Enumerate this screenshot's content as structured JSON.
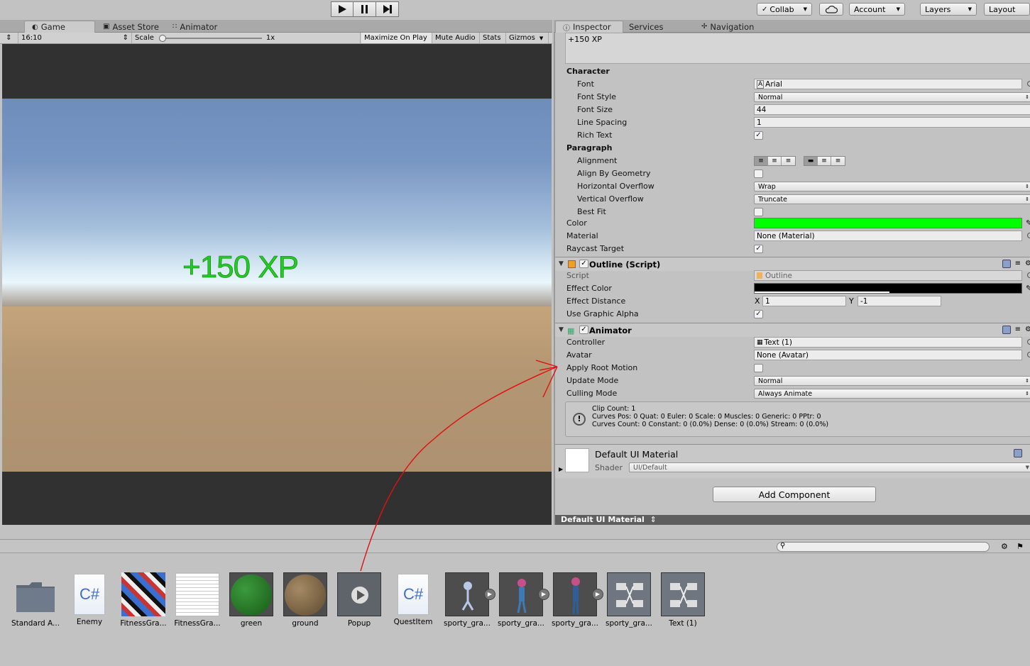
{
  "toolbar": {
    "play_icon": "play-icon",
    "pause_icon": "pause-icon",
    "step_icon": "step-icon",
    "collab": "Collab",
    "account": "Account",
    "layers": "Layers",
    "layout": "Layout"
  },
  "game_tabs": {
    "game": "Game",
    "asset_store": "Asset Store",
    "animator": "Animator"
  },
  "game_bar": {
    "aspect": "16:10",
    "scale_label": "Scale",
    "scale_value": "1x",
    "maximize": "Maximize On Play",
    "mute": "Mute Audio",
    "stats": "Stats",
    "gizmos": "Gizmos"
  },
  "game_view": {
    "xp_text": "+150 XP"
  },
  "inspector_tabs": {
    "inspector": "Inspector",
    "services": "Services",
    "navigation": "Navigation"
  },
  "text_component": {
    "text_value": "+150 XP",
    "character_header": "Character",
    "font_label": "Font",
    "font_value": "Arial",
    "font_style_label": "Font Style",
    "font_style_value": "Normal",
    "font_size_label": "Font Size",
    "font_size_value": "44",
    "line_spacing_label": "Line Spacing",
    "line_spacing_value": "1",
    "rich_text_label": "Rich Text",
    "paragraph_header": "Paragraph",
    "alignment_label": "Alignment",
    "align_by_geometry_label": "Align By Geometry",
    "h_overflow_label": "Horizontal Overflow",
    "h_overflow_value": "Wrap",
    "v_overflow_label": "Vertical Overflow",
    "v_overflow_value": "Truncate",
    "best_fit_label": "Best Fit",
    "color_label": "Color",
    "color_value": "#00ff00",
    "material_label": "Material",
    "material_value": "None (Material)",
    "raycast_label": "Raycast Target"
  },
  "outline_component": {
    "title": "Outline (Script)",
    "script_label": "Script",
    "script_value": "Outline",
    "effect_color_label": "Effect Color",
    "effect_color_value": "#000000",
    "effect_distance_label": "Effect Distance",
    "x_label": "X",
    "x_value": "1",
    "y_label": "Y",
    "y_value": "-1",
    "use_graphic_alpha_label": "Use Graphic Alpha"
  },
  "animator_component": {
    "title": "Animator",
    "controller_label": "Controller",
    "controller_value": "Text (1)",
    "avatar_label": "Avatar",
    "avatar_value": "None (Avatar)",
    "apply_root_motion_label": "Apply Root Motion",
    "update_mode_label": "Update Mode",
    "update_mode_value": "Normal",
    "culling_mode_label": "Culling Mode",
    "culling_mode_value": "Always Animate",
    "info_line1": "Clip Count: 1",
    "info_line2": "Curves Pos: 0 Quat: 0 Euler: 0 Scale: 0 Muscles: 0 Generic: 0 PPtr: 0",
    "info_line3": "Curves Count: 0 Constant: 0 (0.0%) Dense: 0 (0.0%) Stream: 0 (0.0%)"
  },
  "material_section": {
    "title": "Default UI Material",
    "shader_label": "Shader",
    "shader_value": "UI/Default"
  },
  "add_component": "Add Component",
  "preview_bar": "Default UI Material",
  "assets": [
    {
      "name": "Standard A..."
    },
    {
      "name": "Enemy"
    },
    {
      "name": "FitnessGra..."
    },
    {
      "name": "FitnessGra..."
    },
    {
      "name": "green"
    },
    {
      "name": "ground"
    },
    {
      "name": "Popup"
    },
    {
      "name": "QuestItem"
    },
    {
      "name": "sporty_gra..."
    },
    {
      "name": "sporty_gra..."
    },
    {
      "name": "sporty_gra..."
    },
    {
      "name": "sporty_gra..."
    },
    {
      "name": "Text (1)"
    }
  ],
  "cs_label": "C#"
}
